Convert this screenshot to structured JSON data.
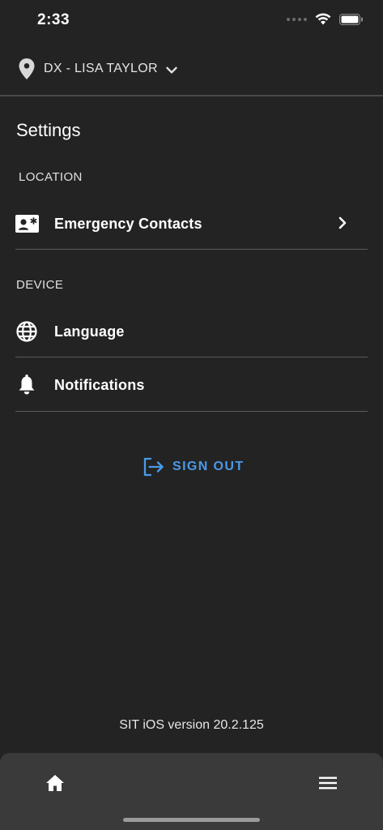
{
  "status_bar": {
    "time": "2:33"
  },
  "header": {
    "location_name": "DX - LISA TAYLOR"
  },
  "page": {
    "title": "Settings"
  },
  "sections": {
    "location": {
      "label": "LOCATION",
      "items": [
        {
          "label": "Emergency Contacts",
          "icon": "contact-card-icon"
        }
      ]
    },
    "device": {
      "label": "DEVICE",
      "items": [
        {
          "label": "Language",
          "icon": "globe-icon"
        },
        {
          "label": "Notifications",
          "icon": "bell-icon"
        }
      ]
    }
  },
  "sign_out": {
    "label": "SIGN OUT",
    "icon": "logout-icon"
  },
  "footer": {
    "version": "SIT iOS version 20.2.125"
  },
  "bottom_nav": {
    "items": [
      {
        "icon": "home-icon"
      },
      {
        "icon": "menu-icon"
      }
    ]
  },
  "colors": {
    "background": "#232323",
    "accent": "#4a9ae8",
    "nav_background": "#3a3a3a"
  }
}
